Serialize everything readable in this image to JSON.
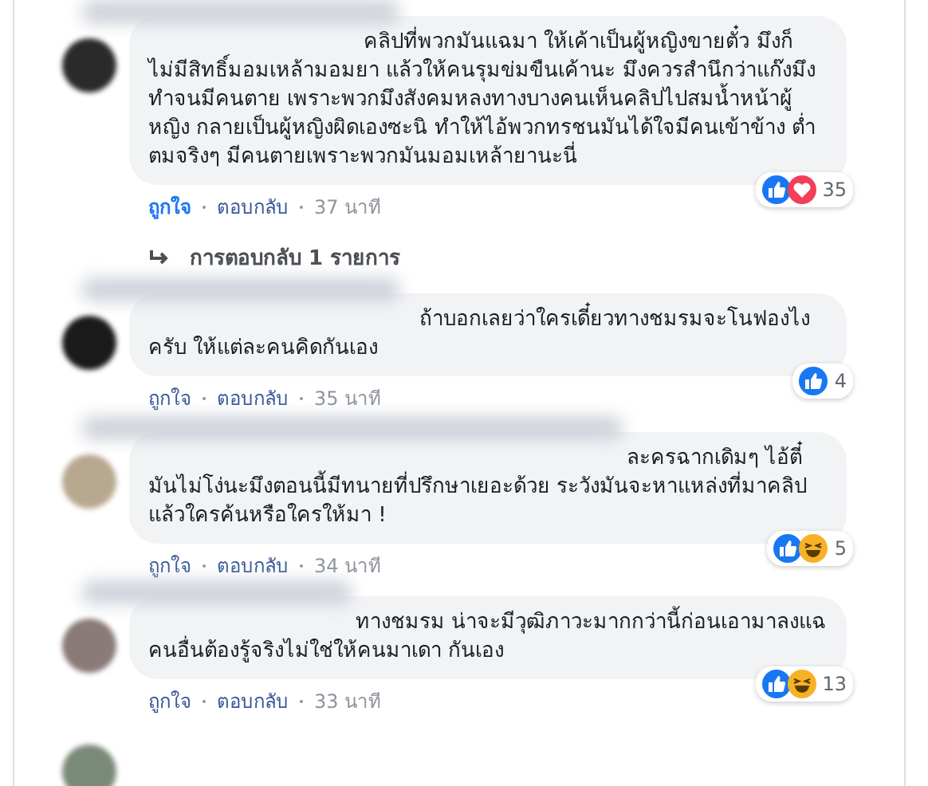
{
  "comments": [
    {
      "text": "คลิปที่พวกมันแฉมา ให้เค้าเป็นผู้หญิงขายตั๋ว มึงก็ไม่มีสิทธิ์มอมเหล้ามอมยา แล้วให้คนรุมข่มขืนเค้านะ มึงควรสำนึกว่าแก๊งมึงทำจนมีคนตาย เพราะพวกมึงสังคมหลงทางบางคนเห็นคลิปไปสมน้ำหน้าผู้หญิง กลายเป็นผู้หญิงผิดเองซะนิ ทำให้ไอ้พวกทรชนมันได้ใจมีคนเข้าข้าง ต่ำตมจริงๆ มีคนตายเพราะพวกมันมอมเหล้ายานะนี่",
      "like_label": "ถูกใจ",
      "liked": true,
      "reply_label": "ตอบกลับ",
      "time": "37 นาที",
      "reactions": [
        {
          "kind": "like"
        },
        {
          "kind": "love"
        }
      ],
      "reaction_count": "35",
      "replies_link": "การตอบกลับ 1 รายการ"
    },
    {
      "text": "ถ้าบอกเลยว่าใครเดี๋ยวทางชมรมจะโนฟองไงครับ ให้แต่ละคนคิดกันเอง",
      "like_label": "ถูกใจ",
      "liked": false,
      "reply_label": "ตอบกลับ",
      "time": "35 นาที",
      "reactions": [
        {
          "kind": "like"
        }
      ],
      "reaction_count": "4"
    },
    {
      "text": "ละครฉากเดิมๆ ไอ้ตี๋มันไม่โง่นะมึงตอนนี้มีทนายที่ปรึกษาเยอะด้วย ระวังมันจะหาแหล่งที่มาคลิปแล้วใครค้นหรือใครให้มา !",
      "like_label": "ถูกใจ",
      "liked": false,
      "reply_label": "ตอบกลับ",
      "time": "34 นาที",
      "reactions": [
        {
          "kind": "like"
        },
        {
          "kind": "haha"
        }
      ],
      "reaction_count": "5"
    },
    {
      "text": "ทางชมรม น่าจะมีวุฒิภาวะมากกว่านี้ก่อนเอามาลงแฉ คนอื่นต้องรู้จริงไม่ใช่ให้คนมาเดา กันเอง",
      "like_label": "ถูกใจ",
      "liked": false,
      "reply_label": "ตอบกลับ",
      "time": "33 นาที",
      "reactions": [
        {
          "kind": "like"
        },
        {
          "kind": "haha"
        }
      ],
      "reaction_count": "13"
    }
  ]
}
